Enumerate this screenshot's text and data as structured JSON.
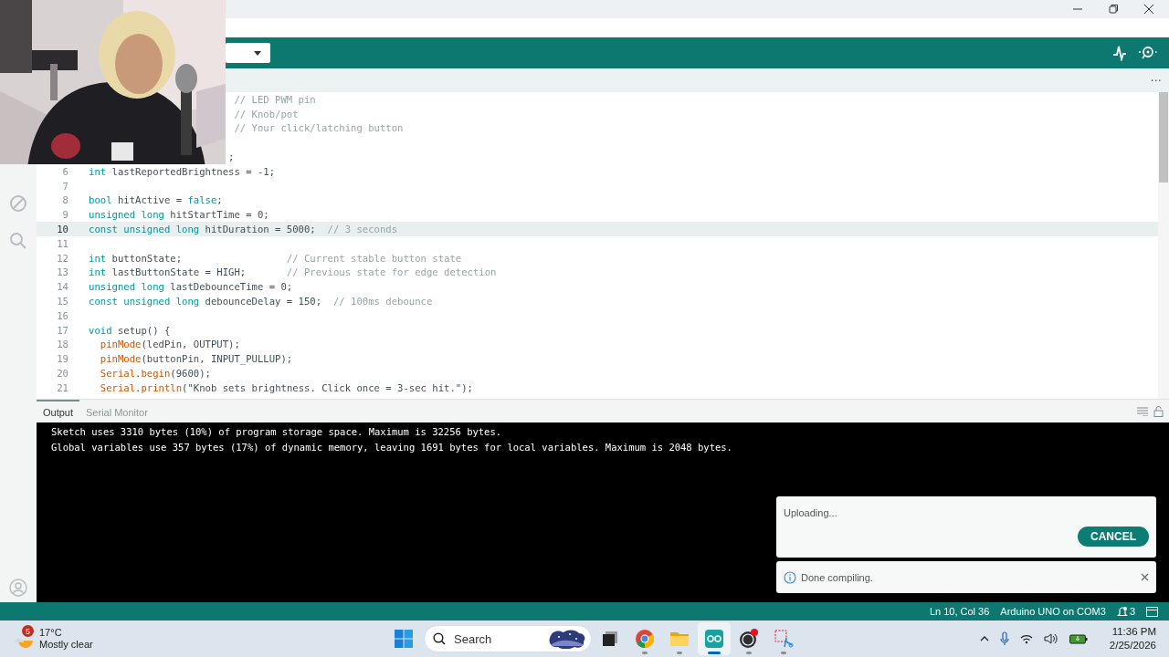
{
  "tab_bar": {
    "more_button": "···"
  },
  "editor": {
    "lines": [
      {
        "selected": false,
        "tokens": [
          {
            "text": "                         // LED PWM pin",
            "kind": "comment"
          }
        ]
      },
      {
        "selected": false,
        "tokens": [
          {
            "text": "                         // Knob/pot",
            "kind": "comment"
          }
        ]
      },
      {
        "selected": false,
        "tokens": [
          {
            "text": "                         // Your click/latching button",
            "kind": "comment"
          }
        ]
      },
      {
        "selected": false
      },
      {
        "selected": false,
        "tokens": [
          {
            "text": "                        ;",
            "kind": "plain"
          }
        ]
      },
      {
        "number": "6",
        "selected": false,
        "tokens": [
          {
            "text": "int",
            "kind": "keyword"
          },
          {
            "text": " lastReportedBrightness = -1;",
            "kind": "plain"
          }
        ]
      },
      {
        "number": "7",
        "selected": false
      },
      {
        "number": "8",
        "selected": false,
        "tokens": [
          {
            "text": "bool",
            "kind": "keyword"
          },
          {
            "text": " hitActive = ",
            "kind": "plain"
          },
          {
            "text": "false",
            "kind": "keyword"
          },
          {
            "text": ";",
            "kind": "plain"
          }
        ]
      },
      {
        "number": "9",
        "selected": false,
        "tokens": [
          {
            "text": "unsigned long",
            "kind": "keyword"
          },
          {
            "text": " hitStartTime = 0;",
            "kind": "plain"
          }
        ]
      },
      {
        "number": "10",
        "selected": true,
        "tokens": [
          {
            "text": "const unsigned long",
            "kind": "keyword"
          },
          {
            "text": " hitDuration = 5000;  ",
            "kind": "plain"
          },
          {
            "text": "// 3 seconds",
            "kind": "comment"
          }
        ]
      },
      {
        "number": "11",
        "selected": false
      },
      {
        "number": "12",
        "selected": false,
        "tokens": [
          {
            "text": "int",
            "kind": "keyword"
          },
          {
            "text": " buttonState;                  ",
            "kind": "plain"
          },
          {
            "text": "// Current stable button state",
            "kind": "comment"
          }
        ]
      },
      {
        "number": "13",
        "selected": false,
        "tokens": [
          {
            "text": "int",
            "kind": "keyword"
          },
          {
            "text": " lastButtonState = HIGH;       ",
            "kind": "plain"
          },
          {
            "text": "// Previous state for edge detection",
            "kind": "comment"
          }
        ]
      },
      {
        "number": "14",
        "selected": false,
        "tokens": [
          {
            "text": "unsigned long",
            "kind": "keyword"
          },
          {
            "text": " lastDebounceTime = 0;",
            "kind": "plain"
          }
        ]
      },
      {
        "number": "15",
        "selected": false,
        "tokens": [
          {
            "text": "const unsigned long",
            "kind": "keyword"
          },
          {
            "text": " debounceDelay = 150;  ",
            "kind": "plain"
          },
          {
            "text": "// 100ms debounce",
            "kind": "comment"
          }
        ]
      },
      {
        "number": "16",
        "selected": false
      },
      {
        "number": "17",
        "selected": false,
        "tokens": [
          {
            "text": "void",
            "kind": "keyword"
          },
          {
            "text": " setup() {",
            "kind": "plain"
          }
        ]
      },
      {
        "number": "18",
        "selected": false,
        "tokens": [
          {
            "text": "  pinMode",
            "kind": "function"
          },
          {
            "text": "(ledPin, OUTPUT);",
            "kind": "plain"
          }
        ]
      },
      {
        "number": "19",
        "selected": false,
        "tokens": [
          {
            "text": "  pinMode",
            "kind": "function"
          },
          {
            "text": "(buttonPin, INPUT_PULLUP);",
            "kind": "plain"
          }
        ]
      },
      {
        "number": "20",
        "selected": false,
        "tokens": [
          {
            "text": "  Serial",
            "kind": "function"
          },
          {
            "text": ".",
            "kind": "plain"
          },
          {
            "text": "begin",
            "kind": "function"
          },
          {
            "text": "(9600);",
            "kind": "plain"
          }
        ]
      },
      {
        "number": "21",
        "selected": false,
        "tokens": [
          {
            "text": "  Serial",
            "kind": "function"
          },
          {
            "text": ".",
            "kind": "plain"
          },
          {
            "text": "println",
            "kind": "function"
          },
          {
            "text": "(\"Knob sets brightness. Click once = 3-sec hit.\");",
            "kind": "plain"
          }
        ]
      }
    ]
  },
  "output": {
    "tabs": [
      {
        "label": "Output",
        "selected": true
      },
      {
        "label": "Serial Monitor",
        "selected": false
      }
    ],
    "lines": [
      "Sketch uses 3310 bytes (10%) of program storage space. Maximum is 32256 bytes.",
      "Global variables use 357 bytes (17%) of dynamic memory, leaving 1691 bytes for local variables. Maximum is 2048 bytes."
    ]
  },
  "notifications": [
    {
      "kind": "progress",
      "message": "Uploading...",
      "button": "CANCEL"
    },
    {
      "kind": "info",
      "message": "Done compiling."
    }
  ],
  "status_bar": {
    "position": "Ln 10, Col 36",
    "board": "Arduino UNO on COM3",
    "notification_count": "3"
  },
  "taskbar": {
    "weather": {
      "badge": "5",
      "temperature": "17°C",
      "condition": "Mostly clear"
    },
    "search": {
      "placeholder": "Search"
    },
    "apps": [
      {
        "kind": "taskview",
        "selected": false,
        "running": false
      },
      {
        "kind": "chrome",
        "selected": false,
        "running": true
      },
      {
        "kind": "files",
        "selected": false,
        "running": true
      },
      {
        "kind": "arduino",
        "selected": true,
        "running": true
      },
      {
        "kind": "obs",
        "selected": false,
        "running": true
      },
      {
        "kind": "snip",
        "selected": false,
        "running": true
      }
    ],
    "clock": {
      "time": "11:36 PM",
      "date": "2/25/2026"
    }
  }
}
